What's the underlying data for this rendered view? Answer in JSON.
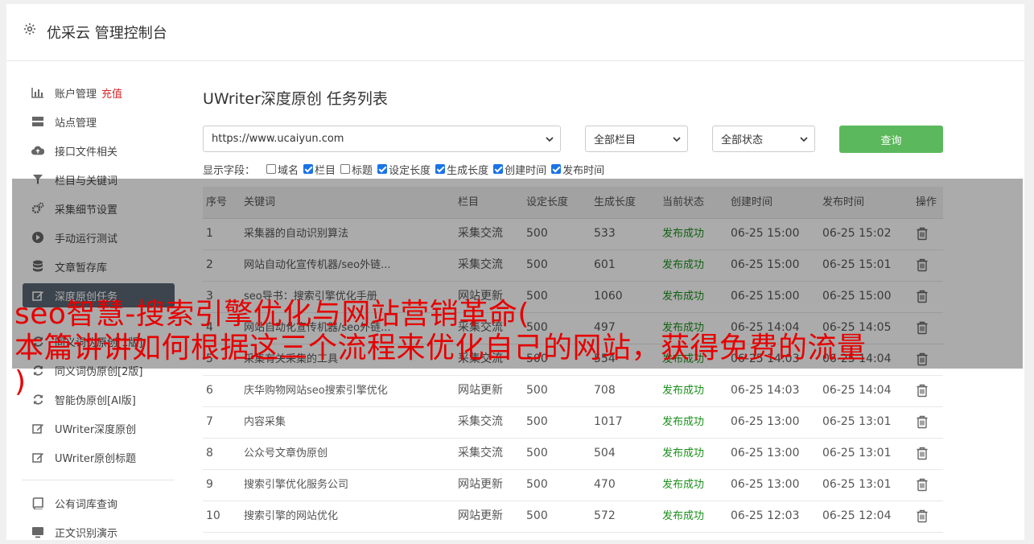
{
  "header": {
    "title": "优采云 管理控制台"
  },
  "sidebar": {
    "items": [
      {
        "label": "账户管理",
        "icon": "bar-chart-icon"
      },
      {
        "label": "站点管理",
        "icon": "server-icon"
      },
      {
        "label": "接口文件相关",
        "icon": "cloud-upload-icon"
      },
      {
        "label": "栏目与关键词",
        "icon": "filter-icon"
      },
      {
        "label": "采集细节设置",
        "icon": "gears-icon"
      },
      {
        "label": "手动运行测试",
        "icon": "play-icon"
      },
      {
        "label": "文章暂存库",
        "icon": "database-icon"
      },
      {
        "label": "深度原创任务",
        "icon": "edit-icon"
      },
      {
        "label": "同义词伪原创[1版]",
        "icon": "refresh-icon"
      },
      {
        "label": "同义词伪原创[2版]",
        "icon": "refresh-icon"
      },
      {
        "label": "智能伪原创[AI版]",
        "icon": "refresh-icon"
      },
      {
        "label": "UWriter深度原创",
        "icon": "edit-icon"
      },
      {
        "label": "UWriter原创标题",
        "icon": "edit-icon"
      },
      {
        "label": "公有词库查询",
        "icon": "book-icon"
      },
      {
        "label": "正文识别演示",
        "icon": "monitor-icon"
      }
    ],
    "recharge": "充值",
    "active_index": 7
  },
  "main": {
    "title": "UWriter深度原创 任务列表",
    "site_select": "https://www.ucaiyun.com",
    "column_select": "全部栏目",
    "status_select": "全部状态",
    "query_button": "查询",
    "fields_label": "显示字段：",
    "fields": [
      {
        "label": "域名",
        "checked": false
      },
      {
        "label": "栏目",
        "checked": true
      },
      {
        "label": "标题",
        "checked": false
      },
      {
        "label": "设定长度",
        "checked": true
      },
      {
        "label": "生成长度",
        "checked": true
      },
      {
        "label": "创建时间",
        "checked": true
      },
      {
        "label": "发布时间",
        "checked": true
      }
    ]
  },
  "table": {
    "headers": [
      "序号",
      "关键词",
      "栏目",
      "设定长度",
      "生成长度",
      "当前状态",
      "创建时间",
      "发布时间",
      "操作"
    ],
    "rows": [
      [
        "1",
        "采集器的自动识别算法",
        "采集交流",
        "500",
        "533",
        "发布成功",
        "06-25 15:00",
        "06-25 15:02"
      ],
      [
        "2",
        "网站自动化宣传机器/seo外链...",
        "采集交流",
        "500",
        "601",
        "发布成功",
        "06-25 15:00",
        "06-25 15:01"
      ],
      [
        "3",
        "seo导书：搜索引擎优化手册",
        "网站更新",
        "500",
        "1060",
        "发布成功",
        "06-25 15:00",
        "06-25 15:00"
      ],
      [
        "4",
        "网站自动化宣传机器/seo外链...",
        "采集交流",
        "500",
        "497",
        "发布成功",
        "06-25 14:04",
        "06-25 14:05"
      ],
      [
        "5",
        "采集有关采集的工具",
        "采集交流",
        "500",
        "554",
        "发布成功",
        "06-25 14:03",
        "06-25 14:04"
      ],
      [
        "6",
        "庆华购物网站seo搜索引擎优化",
        "网站更新",
        "500",
        "708",
        "发布成功",
        "06-25 14:03",
        "06-25 14:04"
      ],
      [
        "7",
        "内容采集",
        "采集交流",
        "500",
        "1017",
        "发布成功",
        "06-25 13:00",
        "06-25 13:01"
      ],
      [
        "8",
        "公众号文章伪原创",
        "采集交流",
        "500",
        "504",
        "发布成功",
        "06-25 13:00",
        "06-25 13:01"
      ],
      [
        "9",
        "搜索引擎优化服务公司",
        "网站更新",
        "500",
        "470",
        "发布成功",
        "06-25 13:00",
        "06-25 13:01"
      ],
      [
        "10",
        "搜索引擎的网站优化",
        "网站更新",
        "500",
        "572",
        "发布成功",
        "06-25 12:03",
        "06-25 12:04"
      ]
    ]
  },
  "banner": {
    "line1": "seo智慧-搜索引擎优化与网站营销革命(",
    "line2": "本篇讲讲如何根据这三个流程来优化自己的网站，获得免费的流量",
    "line3": ")"
  },
  "colors": {
    "accent_green": "#5cb85c",
    "status_green": "#1a8f1a",
    "recharge_red": "#d9262b",
    "headline_red": "#e60000"
  }
}
